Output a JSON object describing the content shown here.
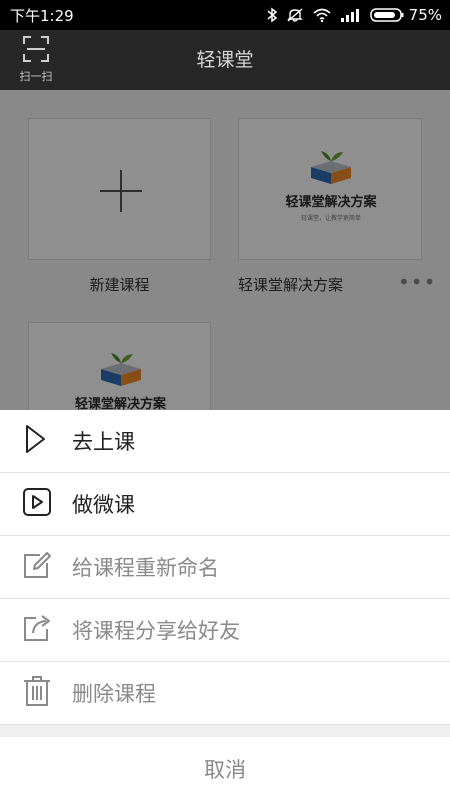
{
  "status_bar": {
    "time": "下午1:29",
    "battery_percent": "75%",
    "icons": [
      "bluetooth-icon",
      "mute-icon",
      "wifi-icon",
      "signal-icon",
      "battery-icon"
    ]
  },
  "header": {
    "scan_label": "扫一扫",
    "title": "轻课堂"
  },
  "courses": [
    {
      "label": "新建课程",
      "icon": "plus-icon"
    },
    {
      "label": "轻课堂解决方案",
      "logo_text": "轻课堂解决方案",
      "logo_subtext": "轻课堂，让教学更简单"
    },
    {
      "logo_text": "轻课堂解决方案"
    }
  ],
  "action_sheet": {
    "items": [
      {
        "label": "去上课",
        "icon": "play-icon",
        "enabled": true
      },
      {
        "label": "做微课",
        "icon": "micro-course-icon",
        "enabled": true
      },
      {
        "label": "给课程重新命名",
        "icon": "edit-icon",
        "enabled": false
      },
      {
        "label": "将课程分享给好友",
        "icon": "share-icon",
        "enabled": false
      },
      {
        "label": "删除课程",
        "icon": "trash-icon",
        "enabled": false
      }
    ],
    "cancel": "取消"
  }
}
